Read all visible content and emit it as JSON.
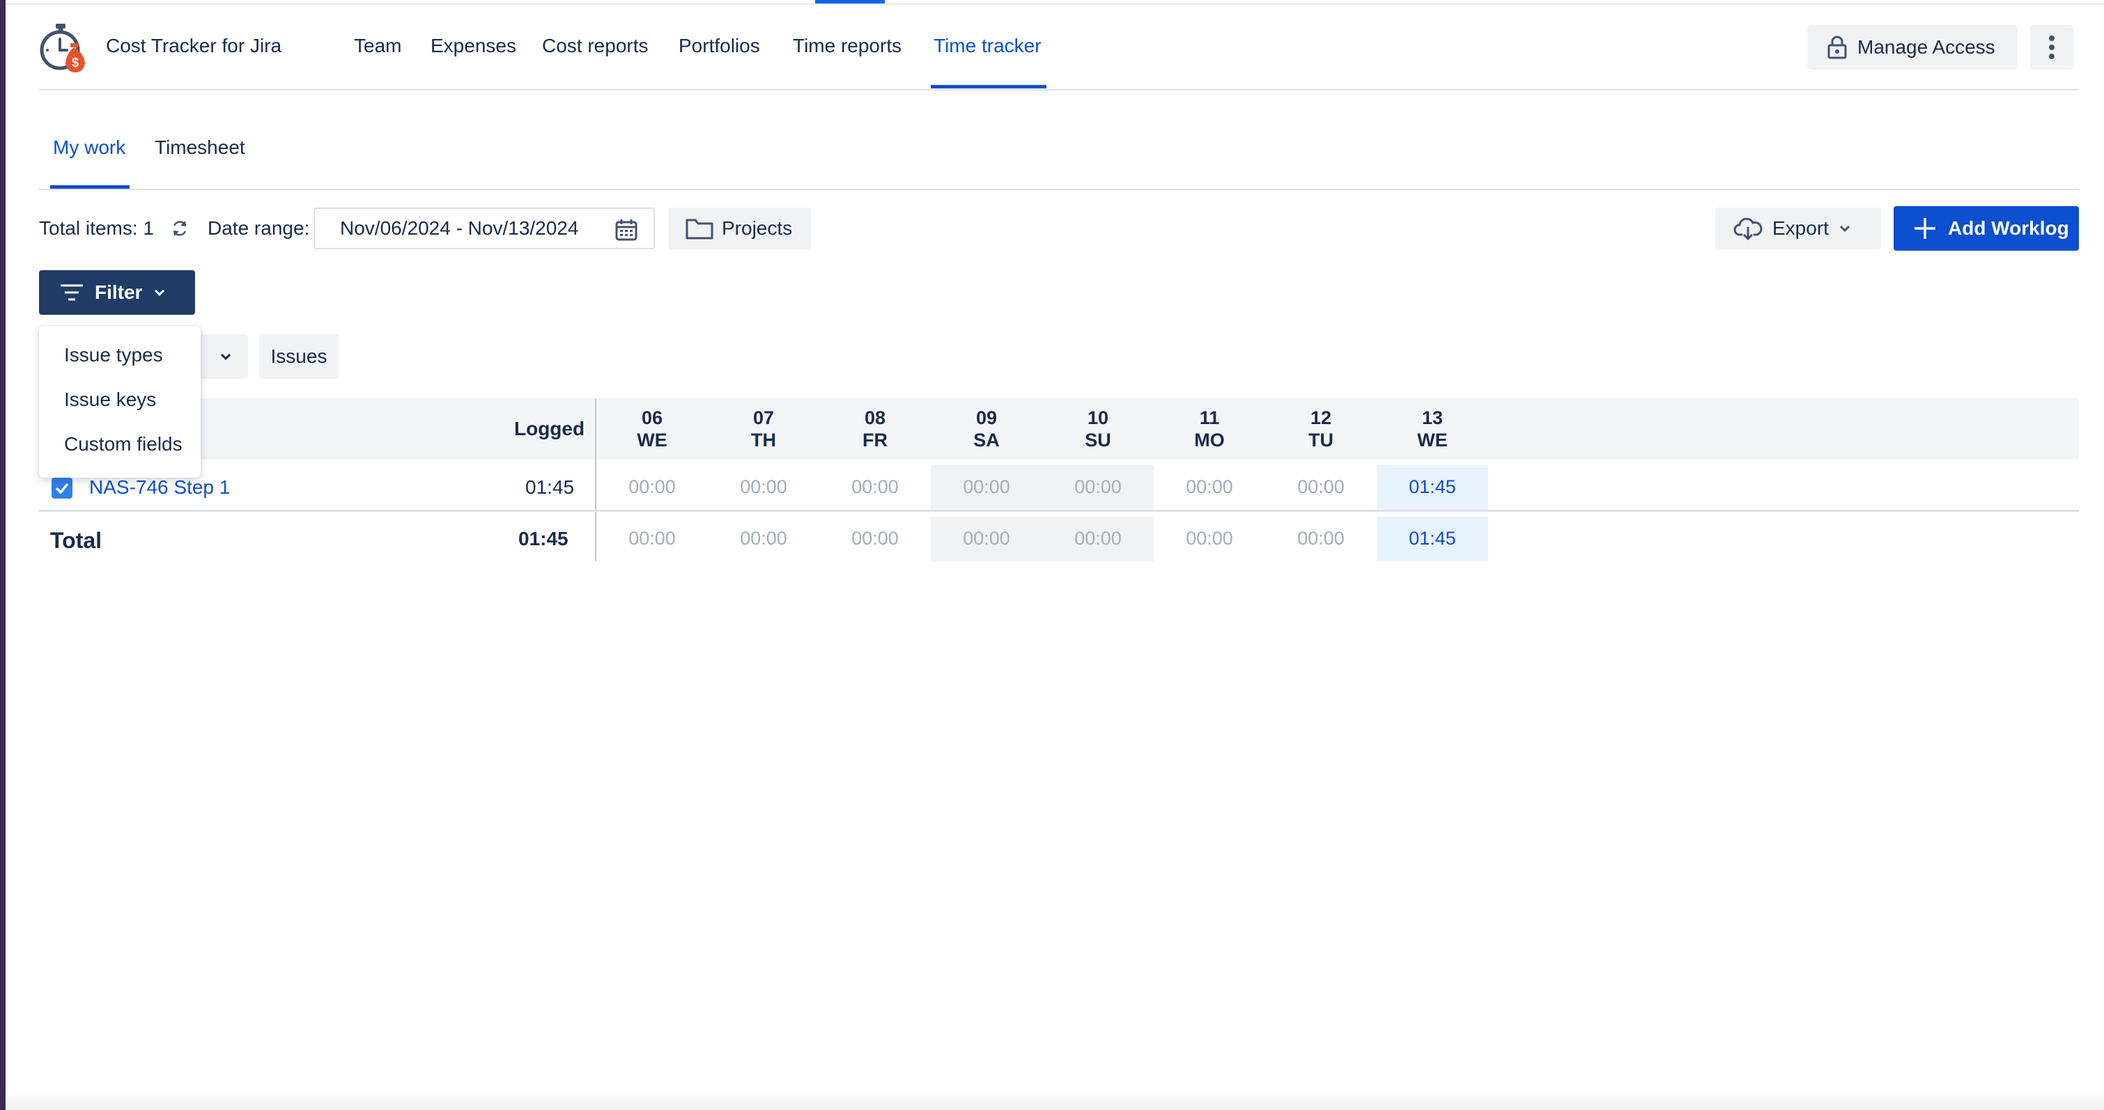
{
  "app": {
    "name": "Cost Tracker for Jira"
  },
  "nav": {
    "items": [
      {
        "label": "Team"
      },
      {
        "label": "Expenses"
      },
      {
        "label": "Cost reports"
      },
      {
        "label": "Portfolios"
      },
      {
        "label": "Time reports"
      },
      {
        "label": "Time tracker",
        "active": true
      }
    ]
  },
  "header": {
    "manage_access_label": "Manage Access"
  },
  "subtabs": [
    {
      "label": "My work",
      "active": true
    },
    {
      "label": "Timesheet"
    }
  ],
  "toolbar": {
    "total_items": "Total items: 1",
    "date_range_label": "Date range:",
    "date_range_value": "Nov/06/2024 - Nov/13/2024",
    "projects_label": "Projects",
    "export_label": "Export",
    "add_worklog_label": "Add Worklog",
    "filter_label": "Filter"
  },
  "filter_chips": {
    "issues_label": "Issues"
  },
  "filter_menu": {
    "items": [
      {
        "label": "Issue types"
      },
      {
        "label": "Issue keys"
      },
      {
        "label": "Custom fields"
      }
    ]
  },
  "table": {
    "logged_header": "Logged",
    "days": [
      {
        "num": "06",
        "dow": "WE"
      },
      {
        "num": "07",
        "dow": "TH"
      },
      {
        "num": "08",
        "dow": "FR"
      },
      {
        "num": "09",
        "dow": "SA",
        "weekend": true
      },
      {
        "num": "10",
        "dow": "SU",
        "weekend": true
      },
      {
        "num": "11",
        "dow": "MO"
      },
      {
        "num": "12",
        "dow": "TU"
      },
      {
        "num": "13",
        "dow": "WE",
        "today": true
      }
    ],
    "rows": [
      {
        "issue": "NAS-746 Step 1",
        "checked": true,
        "logged": "01:45",
        "cells": [
          "00:00",
          "00:00",
          "00:00",
          "00:00",
          "00:00",
          "00:00",
          "00:00",
          "01:45"
        ]
      }
    ],
    "total": {
      "label": "Total",
      "logged": "01:45",
      "cells": [
        "00:00",
        "00:00",
        "00:00",
        "00:00",
        "00:00",
        "00:00",
        "00:00",
        "01:45"
      ]
    }
  },
  "colors": {
    "primary": "#0c4fcf",
    "filter_button": "#1f3b66",
    "logo_accent": "#e5532d"
  }
}
